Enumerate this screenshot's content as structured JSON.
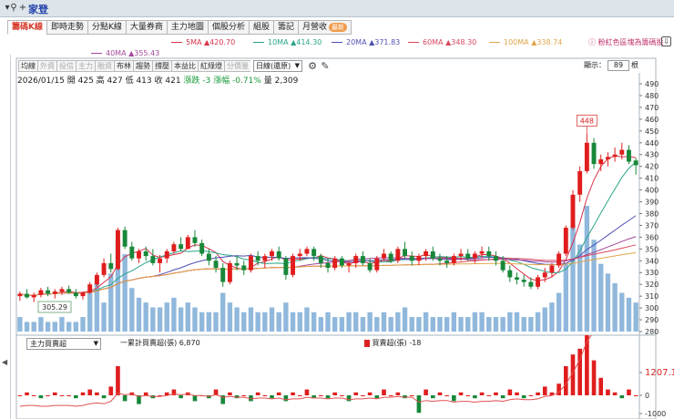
{
  "window": {
    "title": "家登"
  },
  "tabs": [
    {
      "label": "籌碼K線",
      "active": true
    },
    {
      "label": "即時走勢"
    },
    {
      "label": "分點K線"
    },
    {
      "label": "大量券商"
    },
    {
      "label": "主力地圖"
    },
    {
      "label": "個股分析"
    },
    {
      "label": "組股"
    },
    {
      "label": "籌記"
    },
    {
      "label": "月營收",
      "badge": "最新"
    }
  ],
  "ma_legend": [
    {
      "label": "5MA ▲420.70",
      "color": "#d9334a"
    },
    {
      "label": "10MA ▲414.30",
      "color": "#2aa58a"
    },
    {
      "label": "20MA ▲371.83",
      "color": "#4d4fb3"
    },
    {
      "label": "60MA ▲348.30",
      "color": "#d9475e"
    },
    {
      "label": "100MA ▲338.74",
      "color": "#e0a54a"
    },
    {
      "label": "40MA ▲355.43",
      "color": "#a4489a"
    }
  ],
  "ma_hint": "粉紅色區塊為籌碼股",
  "toolbar": {
    "buttons": [
      "均線",
      "外資",
      "投信",
      "主力",
      "融資",
      "布林",
      "趨勢",
      "撐壓",
      "本益比",
      "紅綠燈",
      "分價量"
    ],
    "dim": [
      1,
      2,
      3,
      4,
      10
    ],
    "period": "日線(還原)",
    "display_label": "顯示：",
    "display_count": "89",
    "display_unit": "根"
  },
  "info": {
    "date": "2026/01/15",
    "open": "開 425",
    "high": "高 427",
    "low": "低 413",
    "close": "收 421",
    "change": "漲跌 -3",
    "pct": "漲幅 -0.71%",
    "volume": "量 2,309"
  },
  "price_axis": [
    "490",
    "480",
    "470",
    "460",
    "450",
    "440",
    "430",
    "420",
    "410",
    "400",
    "390",
    "380",
    "370",
    "360",
    "350",
    "340",
    "330",
    "320",
    "310",
    "300",
    "290",
    "280"
  ],
  "high_marker": "448",
  "low_marker": "305.29",
  "sub_panel": {
    "selector": "主力買賣超",
    "legend1": "一累計買賣超(張) 6,870",
    "legend2": "買賣超(張) -18",
    "axis": [
      "1207.1",
      "0",
      "-1000"
    ]
  },
  "chart_data": {
    "type": "candlestick",
    "bars": 89,
    "ylim": [
      280,
      490
    ],
    "candles": [
      [
        310,
        314,
        306,
        312
      ],
      [
        312,
        316,
        308,
        309
      ],
      [
        309,
        313,
        305,
        311
      ],
      [
        311,
        317,
        309,
        315
      ],
      [
        315,
        318,
        310,
        312
      ],
      [
        312,
        316,
        308,
        314
      ],
      [
        314,
        318,
        311,
        316
      ],
      [
        316,
        319,
        312,
        313
      ],
      [
        313,
        316,
        308,
        310
      ],
      [
        310,
        314,
        307,
        313
      ],
      [
        313,
        322,
        312,
        320
      ],
      [
        320,
        330,
        318,
        328
      ],
      [
        328,
        342,
        326,
        338
      ],
      [
        338,
        346,
        330,
        333
      ],
      [
        333,
        368,
        332,
        366
      ],
      [
        366,
        369,
        350,
        352
      ],
      [
        352,
        356,
        340,
        342
      ],
      [
        342,
        350,
        338,
        348
      ],
      [
        348,
        352,
        340,
        344
      ],
      [
        344,
        350,
        336,
        338
      ],
      [
        338,
        345,
        330,
        342
      ],
      [
        342,
        350,
        338,
        348
      ],
      [
        348,
        356,
        346,
        354
      ],
      [
        354,
        360,
        348,
        350
      ],
      [
        350,
        362,
        350,
        360
      ],
      [
        360,
        366,
        352,
        355
      ],
      [
        355,
        358,
        344,
        346
      ],
      [
        346,
        350,
        336,
        340
      ],
      [
        340,
        344,
        330,
        334
      ],
      [
        334,
        338,
        318,
        322
      ],
      [
        322,
        340,
        320,
        338
      ],
      [
        338,
        344,
        332,
        336
      ],
      [
        336,
        340,
        328,
        332
      ],
      [
        332,
        346,
        330,
        344
      ],
      [
        344,
        348,
        336,
        340
      ],
      [
        340,
        346,
        334,
        344
      ],
      [
        344,
        350,
        340,
        348
      ],
      [
        348,
        352,
        340,
        342
      ],
      [
        342,
        344,
        324,
        328
      ],
      [
        328,
        346,
        326,
        344
      ],
      [
        344,
        350,
        340,
        346
      ],
      [
        346,
        352,
        344,
        350
      ],
      [
        350,
        352,
        340,
        344
      ],
      [
        344,
        346,
        334,
        338
      ],
      [
        338,
        342,
        330,
        334
      ],
      [
        334,
        344,
        332,
        342
      ],
      [
        342,
        344,
        334,
        336
      ],
      [
        336,
        340,
        330,
        338
      ],
      [
        338,
        346,
        334,
        344
      ],
      [
        344,
        348,
        336,
        338
      ],
      [
        338,
        342,
        330,
        332
      ],
      [
        332,
        344,
        330,
        342
      ],
      [
        342,
        350,
        340,
        346
      ],
      [
        346,
        348,
        338,
        340
      ],
      [
        340,
        352,
        338,
        350
      ],
      [
        350,
        356,
        342,
        344
      ],
      [
        344,
        348,
        336,
        340
      ],
      [
        340,
        346,
        336,
        344
      ],
      [
        344,
        350,
        340,
        348
      ],
      [
        348,
        352,
        340,
        342
      ],
      [
        342,
        346,
        336,
        340
      ],
      [
        340,
        344,
        334,
        338
      ],
      [
        338,
        346,
        336,
        344
      ],
      [
        344,
        350,
        340,
        346
      ],
      [
        346,
        350,
        340,
        342
      ],
      [
        342,
        348,
        338,
        346
      ],
      [
        346,
        352,
        342,
        348
      ],
      [
        348,
        352,
        340,
        344
      ],
      [
        344,
        348,
        336,
        340
      ],
      [
        340,
        344,
        330,
        332
      ],
      [
        332,
        336,
        322,
        326
      ],
      [
        326,
        330,
        320,
        324
      ],
      [
        324,
        328,
        318,
        322
      ],
      [
        322,
        326,
        316,
        318
      ],
      [
        318,
        328,
        316,
        326
      ],
      [
        326,
        334,
        322,
        330
      ],
      [
        330,
        338,
        326,
        336
      ],
      [
        336,
        348,
        334,
        346
      ],
      [
        346,
        370,
        344,
        368
      ],
      [
        368,
        400,
        366,
        396
      ],
      [
        396,
        420,
        390,
        416
      ],
      [
        416,
        448,
        414,
        440
      ],
      [
        440,
        444,
        418,
        422
      ],
      [
        422,
        430,
        416,
        426
      ],
      [
        426,
        432,
        420,
        428
      ],
      [
        428,
        436,
        424,
        430
      ],
      [
        430,
        440,
        426,
        434
      ],
      [
        434,
        438,
        422,
        424
      ],
      [
        425,
        427,
        413,
        421
      ]
    ],
    "volumes": [
      3,
      2,
      2,
      3,
      2,
      2,
      3,
      2,
      2,
      3,
      8,
      10,
      6,
      12,
      19,
      16,
      9,
      7,
      6,
      5,
      5,
      6,
      7,
      5,
      6,
      5,
      4,
      4,
      4,
      8,
      6,
      5,
      4,
      5,
      4,
      4,
      5,
      4,
      6,
      4,
      4,
      5,
      4,
      3,
      4,
      3,
      3,
      4,
      4,
      3,
      4,
      3,
      4,
      3,
      4,
      5,
      3,
      3,
      4,
      3,
      3,
      3,
      4,
      3,
      3,
      4,
      4,
      3,
      3,
      3,
      4,
      4,
      3,
      3,
      4,
      5,
      6,
      8,
      14,
      22,
      18,
      26,
      19,
      14,
      12,
      10,
      8,
      7,
      6
    ],
    "net_buysell": [
      0,
      1,
      0,
      -1,
      0,
      1,
      0,
      0,
      -1,
      1,
      2,
      1,
      -1,
      3,
      10,
      -2,
      1,
      -3,
      1,
      -1,
      0,
      1,
      2,
      -1,
      1,
      -2,
      0,
      -1,
      2,
      -3,
      1,
      -1,
      0,
      -2,
      1,
      0,
      -1,
      1,
      -2,
      1,
      0,
      2,
      -1,
      0,
      -1,
      1,
      0,
      -2,
      1,
      0,
      1,
      -1,
      2,
      0,
      1,
      -1,
      0,
      -6,
      2,
      -1,
      1,
      0,
      -2,
      1,
      0,
      -1,
      1,
      0,
      1,
      -1,
      2,
      1,
      -1,
      0,
      1,
      3,
      1,
      4,
      10,
      14,
      16,
      22,
      12,
      6,
      2,
      1,
      -1,
      2,
      0
    ]
  }
}
